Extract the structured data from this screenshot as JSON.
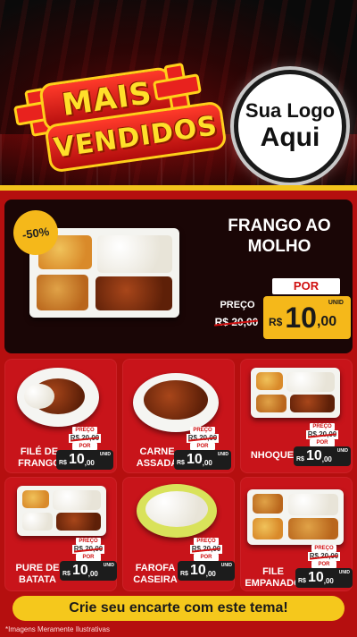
{
  "header": {
    "title_line1": "MAIS",
    "title_line2": "VENDIDOS",
    "logo_line1": "Sua Logo",
    "logo_line2": "Aqui"
  },
  "featured": {
    "discount": "-50%",
    "name": "FRANGO AO MOLHO",
    "preco_label": "PREÇO",
    "old_price": "R$ 20,00",
    "por_label": "POR",
    "currency": "R$",
    "price_int": "10",
    "price_cents": ",00",
    "unit": "UNID"
  },
  "products": [
    {
      "name_line1": "FILÉ DE",
      "name_line2": "FRANGO",
      "preco_label": "PREÇO",
      "old_price": "R$ 20,00",
      "por_label": "POR",
      "currency": "R$",
      "price_int": "10",
      "price_cents": ",00",
      "unit": "UNID"
    },
    {
      "name_line1": "CARNE",
      "name_line2": "ASSADA",
      "preco_label": "PREÇO",
      "old_price": "R$ 20,00",
      "por_label": "POR",
      "currency": "R$",
      "price_int": "10",
      "price_cents": ",00",
      "unit": "UNID"
    },
    {
      "name_line1": "NHOQUE",
      "name_line2": "",
      "preco_label": "PREÇO",
      "old_price": "R$ 20,00",
      "por_label": "POR",
      "currency": "R$",
      "price_int": "10",
      "price_cents": ",00",
      "unit": "UNID"
    },
    {
      "name_line1": "PURE DE",
      "name_line2": "BATATA",
      "preco_label": "PREÇO",
      "old_price": "R$ 20,00",
      "por_label": "POR",
      "currency": "R$",
      "price_int": "10",
      "price_cents": ",00",
      "unit": "UNID"
    },
    {
      "name_line1": "FAROFA",
      "name_line2": "CASEIRA",
      "preco_label": "PREÇO",
      "old_price": "R$ 20,00",
      "por_label": "POR",
      "currency": "R$",
      "price_int": "10",
      "price_cents": ",00",
      "unit": "UNID"
    },
    {
      "name_line1": "FILE",
      "name_line2": "EMPANADO",
      "preco_label": "PREÇO",
      "old_price": "R$ 20,00",
      "por_label": "POR",
      "currency": "R$",
      "price_int": "10",
      "price_cents": ",00",
      "unit": "UNID"
    }
  ],
  "cta": "Crie seu encarte com este tema!",
  "disclaimer": "*Imagens Meramente Ilustrativas",
  "colors": {
    "brand_red": "#b50f0f",
    "accent_yellow": "#f5c81c",
    "dark_panel": "#1a0606"
  }
}
